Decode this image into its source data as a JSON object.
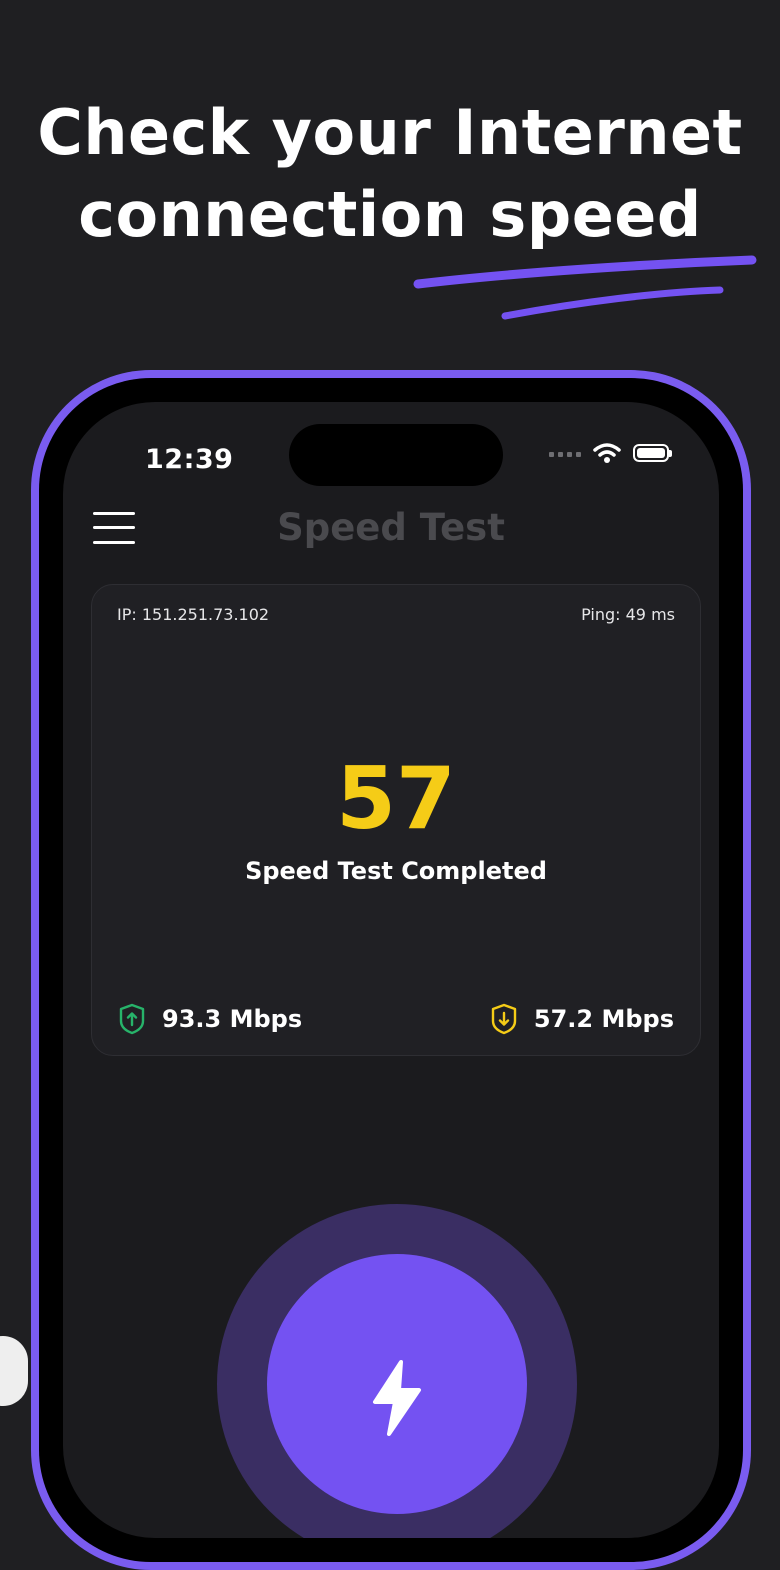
{
  "headline": {
    "line1": "Check your Internet",
    "line2": "connection speed"
  },
  "colors": {
    "accent": "#7452f2",
    "speed": "#f5cc17",
    "upload_icon": "#27b36a",
    "download_icon": "#f5cc17"
  },
  "status_bar": {
    "time": "12:39"
  },
  "app": {
    "title": "Speed Test"
  },
  "result_card": {
    "ip": "IP: 151.251.73.102",
    "ping": "Ping: 49 ms",
    "speed_value": "57",
    "status": "Speed Test Completed",
    "upload": "93.3 Mbps",
    "download": "57.2 Mbps"
  },
  "icons": {
    "menu": "hamburger-icon",
    "upload": "upload-shield-icon",
    "download": "download-shield-icon",
    "start": "lightning-bolt-icon",
    "wifi": "wifi-icon",
    "battery": "battery-icon"
  }
}
